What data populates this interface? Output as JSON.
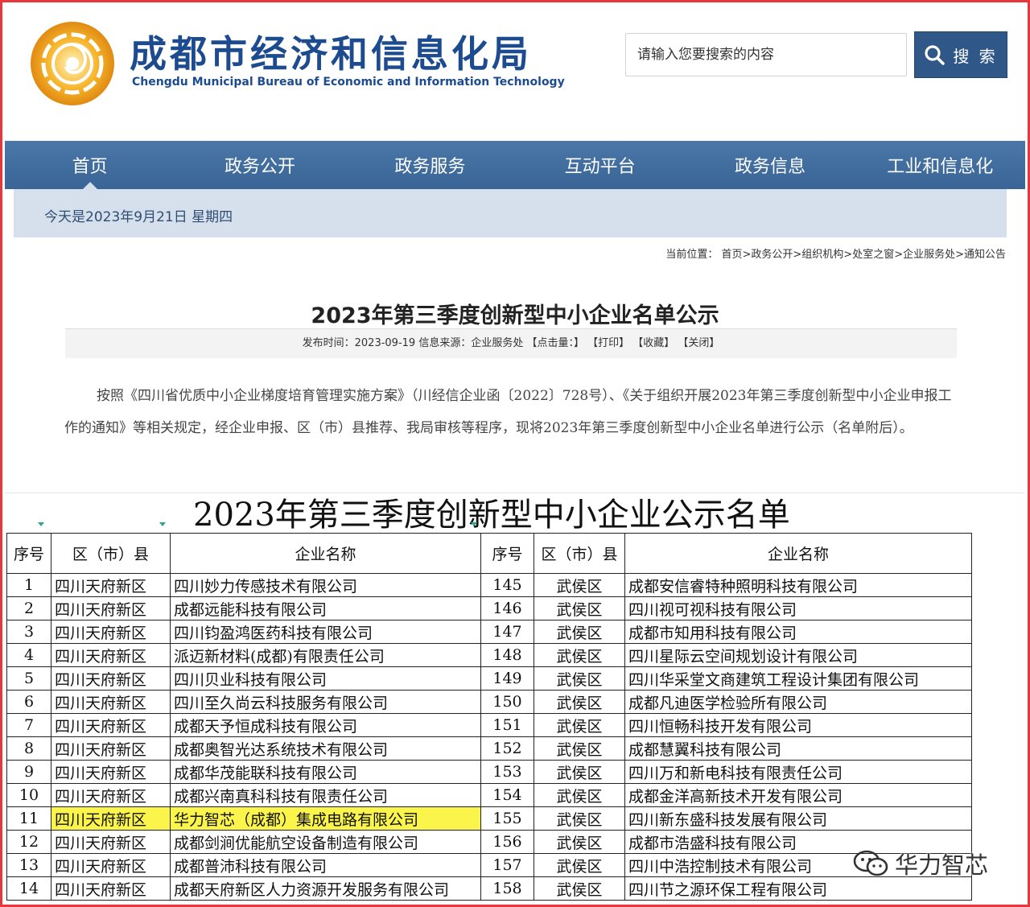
{
  "header": {
    "title": "成都市经济和信息化局",
    "subtitle": "Chengdu Municipal Bureau of Economic and Information Technology",
    "search_placeholder": "请输入您要搜索的内容",
    "search_button": "搜 索"
  },
  "nav": {
    "items": [
      {
        "label": "首页"
      },
      {
        "label": "政务公开"
      },
      {
        "label": "政务服务"
      },
      {
        "label": "互动平台"
      },
      {
        "label": "政务信息"
      },
      {
        "label": "工业和信息化"
      }
    ]
  },
  "date_text": "今天是2023年9月21日 星期四",
  "breadcrumb": "当前位置： 首页>政务公开>组织机构>处室之窗>企业服务处>通知公告",
  "article": {
    "title": "2023年第三季度创新型中小企业名单公示",
    "meta": "发布时间：2023-09-19 信息来源：企业服务处 【点击量：】 【打印】 【收藏】 【关闭】",
    "body": "按照《四川省优质中小企业梯度培育管理实施方案》（川经信企业函〔2022〕728号）、《关于组织开展2023年第三季度创新型中小企业申报工作的通知》等相关规定，经企业申报、区（市）县推荐、我局审核等程序，现将2023年第三季度创新型中小企业名单进行公示（名单附后）。"
  },
  "sheet": {
    "title": "2023年第三季度创新型中小企业公示名单",
    "headers": {
      "seq": "序号",
      "district": "区（市）县",
      "name": "企业名称"
    },
    "rows": [
      {
        "l_seq": "1",
        "l_dist": "四川天府新区",
        "l_name": "四川妙力传感技术有限公司",
        "r_seq": "145",
        "r_dist": "武侯区",
        "r_name": "成都安信睿特种照明科技有限公司"
      },
      {
        "l_seq": "2",
        "l_dist": "四川天府新区",
        "l_name": "成都远能科技有限公司",
        "r_seq": "146",
        "r_dist": "武侯区",
        "r_name": "四川视可视科技有限公司"
      },
      {
        "l_seq": "3",
        "l_dist": "四川天府新区",
        "l_name": "四川钧盈鸿医药科技有限公司",
        "r_seq": "147",
        "r_dist": "武侯区",
        "r_name": "成都市知用科技有限公司"
      },
      {
        "l_seq": "4",
        "l_dist": "四川天府新区",
        "l_name": "派迈新材料(成都)有限责任公司",
        "r_seq": "148",
        "r_dist": "武侯区",
        "r_name": "四川星际云空间规划设计有限公司"
      },
      {
        "l_seq": "5",
        "l_dist": "四川天府新区",
        "l_name": "四川贝业科技有限公司",
        "r_seq": "149",
        "r_dist": "武侯区",
        "r_name": "四川华采堂文商建筑工程设计集团有限公司"
      },
      {
        "l_seq": "6",
        "l_dist": "四川天府新区",
        "l_name": "四川至久尚云科技服务有限公司",
        "r_seq": "150",
        "r_dist": "武侯区",
        "r_name": "成都凡迪医学检验所有限公司"
      },
      {
        "l_seq": "7",
        "l_dist": "四川天府新区",
        "l_name": "成都天予恒成科技有限公司",
        "r_seq": "151",
        "r_dist": "武侯区",
        "r_name": "四川恒畅科技开发有限公司"
      },
      {
        "l_seq": "8",
        "l_dist": "四川天府新区",
        "l_name": "成都奥智光达系统技术有限公司",
        "r_seq": "152",
        "r_dist": "武侯区",
        "r_name": "成都慧翼科技有限公司"
      },
      {
        "l_seq": "9",
        "l_dist": "四川天府新区",
        "l_name": "成都华茂能联科技有限公司",
        "r_seq": "153",
        "r_dist": "武侯区",
        "r_name": "四川万和新电科技有限责任公司"
      },
      {
        "l_seq": "10",
        "l_dist": "四川天府新区",
        "l_name": "成都兴南真科科技有限责任公司",
        "r_seq": "154",
        "r_dist": "武侯区",
        "r_name": "成都金洋高新技术开发有限公司"
      },
      {
        "l_seq": "11",
        "l_dist": "四川天府新区",
        "l_name": "华力智芯（成都）集成电路有限公司",
        "r_seq": "155",
        "r_dist": "武侯区",
        "r_name": "四川新东盛科技发展有限公司",
        "highlight": true
      },
      {
        "l_seq": "12",
        "l_dist": "四川天府新区",
        "l_name": "成都剑涧优能航空设备制造有限公司",
        "r_seq": "156",
        "r_dist": "武侯区",
        "r_name": "成都市浩盛科技有限公司"
      },
      {
        "l_seq": "13",
        "l_dist": "四川天府新区",
        "l_name": "成都普沛科技有限公司",
        "r_seq": "157",
        "r_dist": "武侯区",
        "r_name": "四川中浩控制技术有限公司"
      },
      {
        "l_seq": "14",
        "l_dist": "四川天府新区",
        "l_name": "成都天府新区人力资源开发服务有限公司",
        "r_seq": "158",
        "r_dist": "武侯区",
        "r_name": "四川节之源环保工程有限公司"
      }
    ]
  },
  "watermark": "华力智芯",
  "colors": {
    "brand": "#1d4b8f",
    "nav": "#3e6b9c",
    "date_bar": "#d6e0ec",
    "highlight": "#fbf54b",
    "frame": "#e8363b"
  },
  "icons": {
    "logo": "sun-emblem-icon",
    "search": "search-icon",
    "watermark": "wechat-icon"
  }
}
